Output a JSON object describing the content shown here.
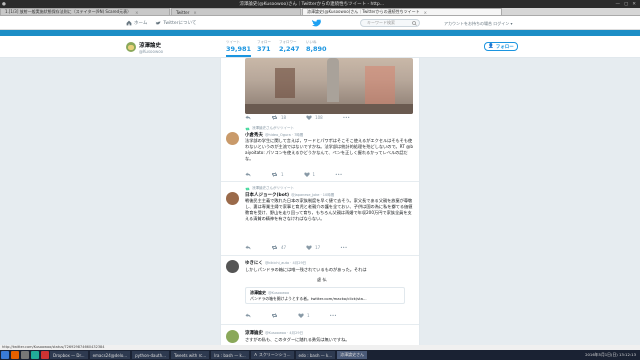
{
  "os": {
    "window_title": "涼澤論史(@Kusoowoo)さん｜Twitterからの連続性ちツイート - http...",
    "minimize": "—",
    "maximize": "▢",
    "close": "✕"
  },
  "tabs": [
    {
      "label": "1.[1/3] 放射一般実施状態保存法則に（ステイター(9N) Scared元表）"
    },
    {
      "label": "Twitter"
    },
    {
      "label": "涼澤論史(@Kusoowoo)さん｜Twitterからの連続性ちツイート"
    }
  ],
  "nav": {
    "home": "ホーム",
    "about": "Twitterについて",
    "search_placeholder": "キーワード検索",
    "login": "アカウントをお持ちの場合 ログイン ▾"
  },
  "profile": {
    "name": "涼澤論史",
    "handle": "@Kusoowoo",
    "stats": [
      {
        "label": "ツイート",
        "value": "39,981"
      },
      {
        "label": "フォロー",
        "value": "371"
      },
      {
        "label": "フォロワー",
        "value": "2,247"
      },
      {
        "label": "いいね",
        "value": "8,890"
      }
    ],
    "follow_label": "フォロー"
  },
  "photo_tweet": {
    "reply": "",
    "retweets": "18",
    "likes": "108"
  },
  "tweets": [
    {
      "rt": "涼澤論史さんがリツイート",
      "name": "小倉秀夫",
      "meta": "@hideo_Ogura · 7時間",
      "text": "法学部の学生に関して言えば，ワードとパワポはそこそこ使えるがエクセルはそもそも使わないというのが主流ではないですかね。法学部は統計的処理を殆どしないので。RT @baiyoitato: パソコンを使えるかどうかなんて、ペンを正しく握れるかってレベルの話だな。",
      "reply": "",
      "retweets": "1",
      "likes": "1"
    },
    {
      "rt": "涼澤論史さんがリツイート",
      "name": "日本人ジョーク(bot)",
      "meta": "@Japanese_Joke · 10時間",
      "text": "戦後民主主義で敗れた日本の家族制度を早く捷て去そう。家父長である父親を放棄が尊敬し、妻は専業主婦で家事と育児と老親介の護を全ておい、子供は国の為に私を擲てる価値教育を受け、野山を走り回って育ち，もちろん父親は再婚で年収200万円で家族全員を支える清貧の精神を有さなければならない。",
      "reply": "",
      "retweets": "47",
      "likes": "17"
    },
    {
      "rt": "",
      "name": "ゆきにく",
      "meta": "@kikichi_auto · 4月29日",
      "text": "しかしパンドラの箱には唯一残されているものがあった。それは",
      "text2": "虚  仏",
      "quote_name": "涼澤論史",
      "quote_handle": "@Kusoowoo",
      "quote_text": "パンドラの箱を開けようとする者。twitter.com/macko/click/sta...",
      "reply": "",
      "retweets": "",
      "likes": "1"
    },
    {
      "rt": "",
      "name": "涼澤論史",
      "meta": "@Kusoowoo · 4月29日",
      "text": "さすがの私も、このタグーに踏れる勇気は無いですね。"
    }
  ],
  "statusbar": "http://twitter.com/Kusoowoo/status/726929874660432384",
  "taskbar": {
    "tasks": [
      "Dropbox — Dr...",
      "emacs24@delo...",
      "python-dauth...",
      "Tweets with rc...",
      "Ira : bash — k...",
      "Ａ スクリーンショ...",
      "edo : bash — k...",
      "涼澤論史さん"
    ],
    "clock": "2016年5月1日(日) 13:12:13"
  },
  "colors": {
    "accent": "#1b95e0",
    "cover": "#1d8ec6"
  }
}
